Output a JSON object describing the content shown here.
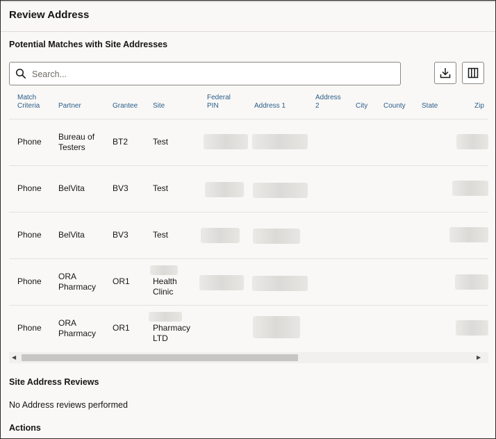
{
  "page": {
    "title": "Review Address",
    "matches_section_title": "Potential Matches with Site Addresses",
    "reviews_section_title": "Site Address Reviews",
    "reviews_empty_text": "No Address reviews performed",
    "actions_title": "Actions"
  },
  "search": {
    "placeholder": "Search...",
    "value": ""
  },
  "toolbar": {
    "download_icon": "download-icon",
    "columns_icon": "columns-icon"
  },
  "table": {
    "columns": [
      {
        "line1": "Match",
        "line2": "Criteria"
      },
      {
        "line1": "Partner",
        "line2": ""
      },
      {
        "line1": "Grantee",
        "line2": ""
      },
      {
        "line1": "Site",
        "line2": ""
      },
      {
        "line1": "Federal",
        "line2": "PIN"
      },
      {
        "line1": "Address 1",
        "line2": ""
      },
      {
        "line1": "Address",
        "line2": "2"
      },
      {
        "line1": "City",
        "line2": ""
      },
      {
        "line1": "County",
        "line2": ""
      },
      {
        "line1": "State",
        "line2": ""
      },
      {
        "line1": "Zip",
        "line2": ""
      }
    ],
    "rows": [
      {
        "criteria": "Phone",
        "partner_1": "Bureau of",
        "partner_2": "Testers",
        "grantee": "BT2",
        "site_1": "Test",
        "site_2": ""
      },
      {
        "criteria": "Phone",
        "partner_1": "BelVita",
        "partner_2": "",
        "grantee": "BV3",
        "site_1": "Test",
        "site_2": ""
      },
      {
        "criteria": "Phone",
        "partner_1": "BelVita",
        "partner_2": "",
        "grantee": "BV3",
        "site_1": "Test",
        "site_2": ""
      },
      {
        "criteria": "Phone",
        "partner_1": "ORA",
        "partner_2": "Pharmacy",
        "grantee": "OR1",
        "site_1": "Health",
        "site_2": "Clinic"
      },
      {
        "criteria": "Phone",
        "partner_1": "ORA",
        "partner_2": "Pharmacy",
        "grantee": "OR1",
        "site_1": "Pharmacy",
        "site_2": "LTD"
      }
    ]
  },
  "colors": {
    "header_text": "#2b5d8b",
    "border": "#8b8781",
    "background": "#f9f8f6"
  }
}
